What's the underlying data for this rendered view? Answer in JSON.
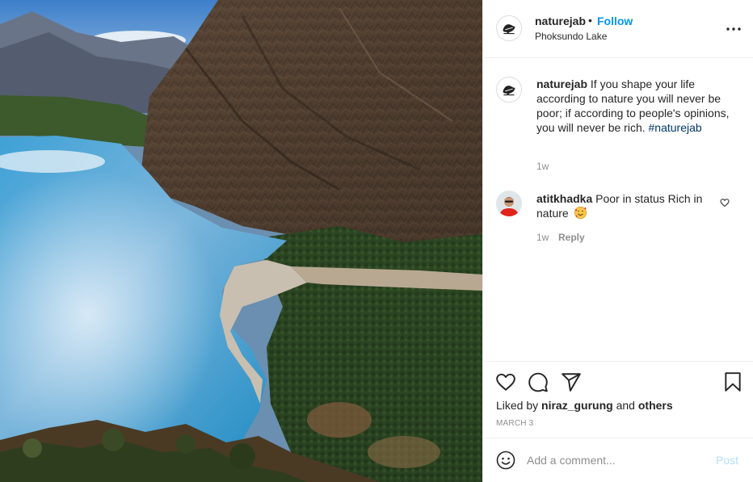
{
  "post": {
    "username": "naturejab",
    "separator": "•",
    "follow_label": "Follow",
    "location": "Phoksundo Lake",
    "image_subject": "Phoksundo Lake"
  },
  "caption": {
    "username": "naturejab",
    "text": "If you shape your life according to nature you will never be poor; if according to people's opinions, you will never be rich.",
    "hashtag": "#naturejab",
    "time": "1w"
  },
  "comments": [
    {
      "username": "atitkhadka",
      "text": "Poor in status Rich in nature",
      "emoji": "smiling-face-with-hearts",
      "time": "1w",
      "reply_label": "Reply"
    }
  ],
  "engagement": {
    "liked_prefix": "Liked by",
    "liked_user": "niraz_gurung",
    "liked_joiner": "and",
    "liked_others": "others",
    "date": "MARCH 3"
  },
  "comment_box": {
    "placeholder": "Add a comment...",
    "post_label": "Post"
  },
  "icons": {
    "more": "more-horizontal-icon",
    "like": "heart-icon",
    "comment": "comment-bubble-icon",
    "share": "paper-plane-icon",
    "save": "bookmark-icon",
    "emoji": "emoji-smile-icon"
  },
  "colors": {
    "accent": "#0095f6",
    "muted": "#8e8e8e",
    "hashtag": "#00376b",
    "post_disabled": "#b2dffc"
  }
}
